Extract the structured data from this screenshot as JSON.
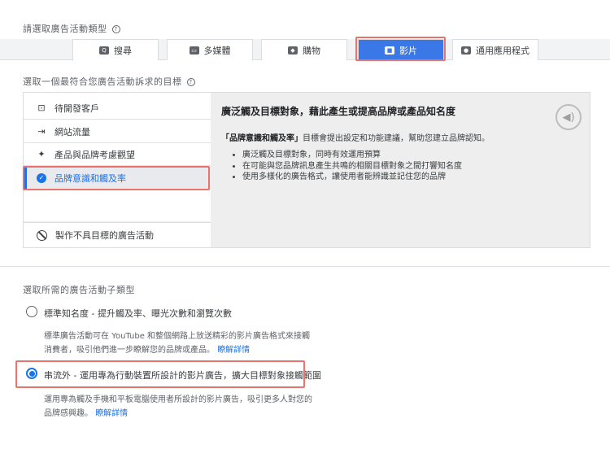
{
  "campaign_type": {
    "title": "請選取廣告活動類型",
    "help_glyph": "?",
    "tabs": [
      {
        "label": "搜尋",
        "icon": "search-icon",
        "glyph": "Q"
      },
      {
        "label": "多媒體",
        "icon": "display-icon",
        "glyph": "▭"
      },
      {
        "label": "購物",
        "icon": "shopping-tag-icon",
        "glyph": "◆"
      },
      {
        "label": "影片",
        "icon": "video-camera-icon",
        "glyph": "■"
      },
      {
        "label": "通用應用程式",
        "icon": "app-icon",
        "glyph": "●"
      }
    ],
    "selected": "影片"
  },
  "goal": {
    "title": "選取一個最符合您廣告活動訴求的目標",
    "help_glyph": "?",
    "items": [
      {
        "label": "待開發客戶",
        "icon": "leads-icon",
        "glyph": "⊡"
      },
      {
        "label": "網站流量",
        "icon": "website-traffic-icon",
        "glyph": "⇥"
      },
      {
        "label": "產品與品牌考慮觀望",
        "icon": "sparkle-icon",
        "glyph": "✦"
      },
      {
        "label": "品牌意識和觸及率",
        "icon": "check-circle-icon",
        "glyph": "✓"
      }
    ],
    "no_goal_label": "製作不具目標的廣告活動",
    "description": {
      "heading": "廣泛觸及目標對象，藉此產生或提高品牌或產品知名度",
      "body_strong": "「品牌意識和觸及率」",
      "body_rest": "目標會提出設定和功能建議，幫助您建立品牌認知。",
      "bullets": [
        "廣泛觸及目標對象，同時有效運用預算",
        "在可能與您品牌訊息產生共鳴的相關目標對象之間打響知名度",
        "使用多樣化的廣告格式，讓使用者能辨識並記住您的品牌"
      ],
      "speaker_glyph": "◀)"
    }
  },
  "subtype": {
    "title": "選取所需的廣告活動子類型",
    "options": [
      {
        "label": "標準知名度 - 提升觸及率、曝光次數和瀏覽次數",
        "desc_line1": "標準廣告活動可在 YouTube 和整個網路上放送精彩的影片廣告格式來接觸",
        "desc_line2": "消費者，吸引他們進一步瞭解您的品牌或產品。",
        "link": "瞭解詳情",
        "checked": false
      },
      {
        "label": "串流外 - 運用專為行動裝置所設計的影片廣告，擴大目標對象接觸範圍",
        "desc_line1": "運用專為觸及手機和平板電腦使用者所設計的影片廣告，吸引更多人對您的",
        "desc_line2": "品牌感興趣。",
        "link": "瞭解詳情",
        "checked": true
      }
    ]
  },
  "colors": {
    "accent": "#1a73e8",
    "selected_tab": "#3b78e7",
    "highlight_annotation": "#e8746e"
  }
}
